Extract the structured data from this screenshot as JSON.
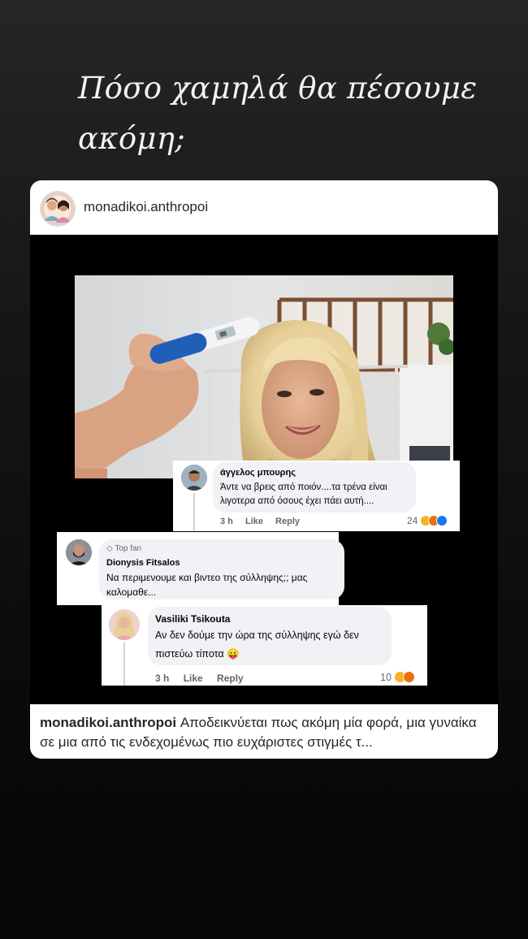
{
  "story": {
    "title_line1": "Πόσο χαμηλά θα πέσουμε",
    "title_line2": "ακόμη;"
  },
  "post": {
    "username": "monadikoi.anthropoi",
    "caption_user": "monadikoi.anthropoi",
    "caption_text": "Αποδεικνύεται πως ακόμη μία φορά, μια γυναίκα  σε μια από τις ενδεχομένως πιο ευχάριστες στιγμές τ..."
  },
  "comments": [
    {
      "name": "άγγελος μπουρης",
      "text_line1": "Άντε να βρεις από ποιόν....τα τρένα είναι",
      "text_line2": "λιγοτερα από όσους έχει πάει αυτή....",
      "time": "3 h",
      "like": "Like",
      "reply": "Reply",
      "reaction_count": "24",
      "reaction_icons": [
        "laugh-icon",
        "angry-icon",
        "like-icon"
      ]
    },
    {
      "badge": "Top fan",
      "name": "Dionysis Fitsalos",
      "text_line1": "Να περιμενουμε και βιντεο της σύλληψης;; μας",
      "text_line2": "καλομαθε..."
    },
    {
      "name": "Vasiliki Tsikouta",
      "text_line1": "Αν δεν δούμε την ώρα της σύλληψης εγώ δεν",
      "text_line2": "πιστεύω τίποτα",
      "emoji": "😛",
      "time": "3 h",
      "like": "Like",
      "reply": "Reply",
      "reaction_count": "10",
      "reaction_icons": [
        "laugh-icon",
        "angry-icon"
      ]
    }
  ],
  "colors": {
    "fb_bubble": "#f0f2f5",
    "fb_meta": "#65676b",
    "like_blue": "#1877f2",
    "haha_yellow": "#f7b125",
    "angry_orange": "#e9710f"
  }
}
